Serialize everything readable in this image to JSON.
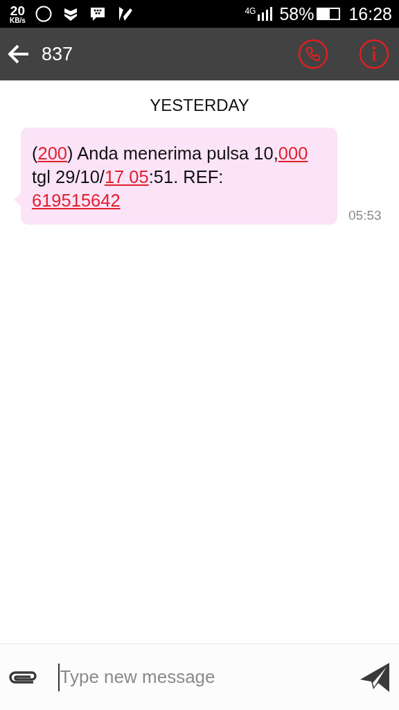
{
  "status_bar": {
    "speed": "20",
    "speed_unit": "KB/s",
    "network": "4G",
    "battery": "58%",
    "time": "16:28"
  },
  "header": {
    "title": "837"
  },
  "date_divider": "YESTERDAY",
  "messages": [
    {
      "time": "05:53",
      "segments": [
        {
          "text": "(",
          "link": false
        },
        {
          "text": "200",
          "link": true
        },
        {
          "text": ") Anda menerima pulsa 10,",
          "link": false
        },
        {
          "text": "000",
          "link": true
        },
        {
          "text": " tgl 29/10/",
          "link": false
        },
        {
          "text": "17 05",
          "link": true
        },
        {
          "text": ":51. REF: ",
          "link": false
        },
        {
          "text": "619515642",
          "link": true
        }
      ]
    }
  ],
  "composer": {
    "placeholder": "Type new message"
  }
}
